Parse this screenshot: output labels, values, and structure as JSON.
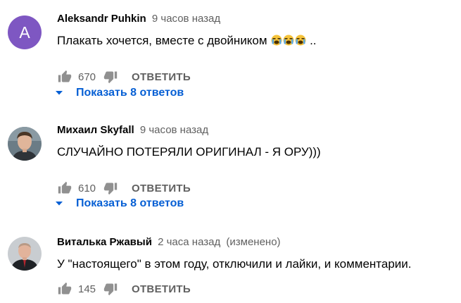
{
  "colors": {
    "link": "#065fd4",
    "secondary_text": "#606060",
    "avatar_letter_bg": "#7e57c2"
  },
  "comments": [
    {
      "avatar_letter": "A",
      "author": "Aleksandr Puhkin",
      "time": "9 часов назад",
      "text": "Плакать хочется, вместе с двойником",
      "text_suffix": "..",
      "emoji": "loudly-crying-face-emoji x3",
      "likes": "670",
      "reply_label": "ОТВЕТИТЬ",
      "show_replies": "Показать 8 ответов"
    },
    {
      "author": "Михаил Skyfall",
      "time": "9 часов назад",
      "text": "СЛУЧАЙНО ПОТЕРЯЛИ ОРИГИНАЛ - Я ОРУ)))",
      "likes": "610",
      "reply_label": "ОТВЕТИТЬ",
      "show_replies": "Показать 8 ответов"
    },
    {
      "author": "Виталька Ржавый",
      "time": "2 часа назад",
      "edited": "(изменено)",
      "text": "У \"настоящего\" в этом году, отключили и лайки, и комментарии.",
      "likes": "145",
      "reply_label": "ОТВЕТИТЬ"
    }
  ]
}
